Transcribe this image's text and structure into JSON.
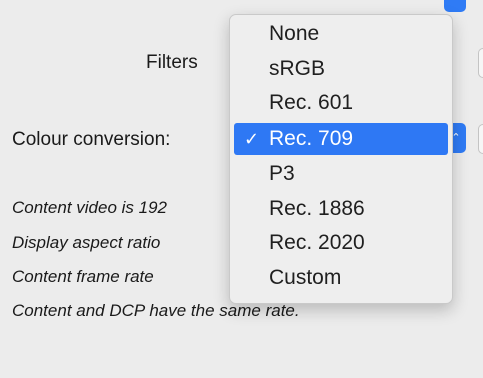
{
  "labels": {
    "filters": "Filters",
    "colour_conversion": "Colour conversion:"
  },
  "info_lines": [
    "Content video is 192",
    "Display aspect ratio",
    "Content frame rate",
    "Content and DCP have the same rate."
  ],
  "colour_menu": {
    "items": [
      {
        "label": "None"
      },
      {
        "label": "sRGB"
      },
      {
        "label": "Rec. 601"
      },
      {
        "label": "Rec. 709",
        "selected": true
      },
      {
        "label": "P3"
      },
      {
        "label": "Rec. 1886"
      },
      {
        "label": "Rec. 2020"
      },
      {
        "label": "Custom"
      }
    ],
    "check_mark": "✓"
  },
  "colors": {
    "accent": "#2e78f4",
    "background": "#ececec",
    "menu_background": "#eeeeee"
  },
  "icons": {
    "selected": "checkmark-icon",
    "stepper": "up-down-chevron-icon"
  }
}
